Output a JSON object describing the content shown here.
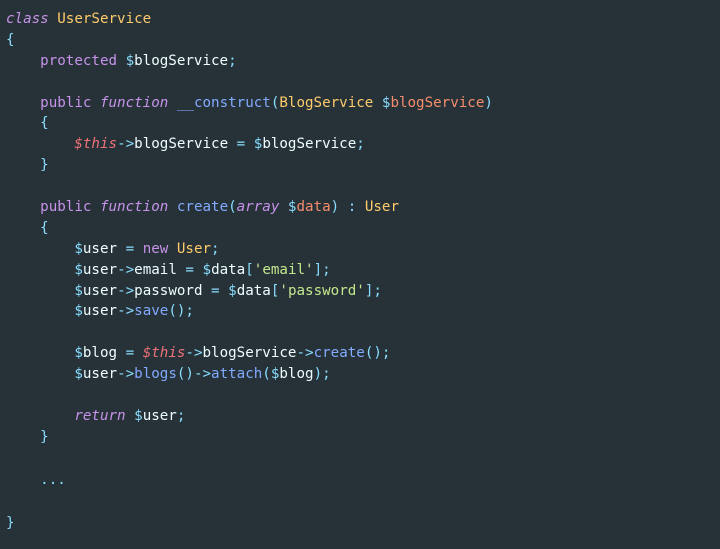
{
  "code": {
    "kw_class": "class",
    "class_name": "UserService",
    "open_brace": "{",
    "close_brace": "}",
    "kw_protected": "protected",
    "kw_public": "public",
    "kw_function": "function",
    "kw_new": "new",
    "kw_return": "return",
    "kw_array": "array",
    "prop_blogService": "blogService",
    "ctor_name": "__construct",
    "param_class": "BlogService",
    "param_name": "blogService",
    "this_kw": "this",
    "method_create": "create",
    "param_data": "data",
    "return_type": "User",
    "var_user": "user",
    "prop_email": "email",
    "str_email": "'email'",
    "prop_password": "password",
    "str_password": "'password'",
    "method_save": "save",
    "var_blog": "blog",
    "method_blogs": "blogs",
    "method_attach": "attach",
    "ellipsis": "..."
  }
}
